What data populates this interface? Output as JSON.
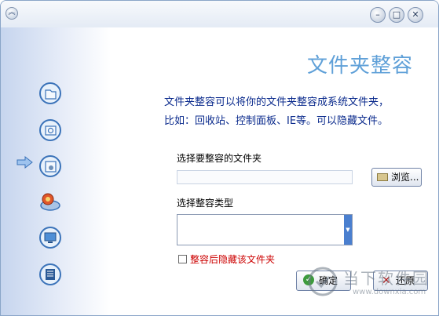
{
  "window": {
    "heading": "文件夹整容",
    "description_line1": "文件夹整容可以将你的文件夹整容成系统文件夹，",
    "description_line2": "比如：回收站、控制面板、IE等。可以隐藏文件。"
  },
  "titlebar": {
    "sysmenu_icon": "chevron-icon",
    "buttons": [
      {
        "name": "minimize",
        "glyph": "–"
      },
      {
        "name": "maximize",
        "glyph": "□"
      },
      {
        "name": "close",
        "glyph": "✕"
      }
    ]
  },
  "sidebar": {
    "selected_index": 2,
    "items": [
      {
        "icon": "folder-icon"
      },
      {
        "icon": "camera-folder-icon"
      },
      {
        "icon": "settings-folder-icon"
      },
      {
        "icon": "disk-tools-icon"
      },
      {
        "icon": "monitor-icon"
      },
      {
        "icon": "system-info-icon"
      }
    ]
  },
  "form": {
    "folder_label": "选择要整容的文件夹",
    "folder_value": "",
    "browse_label": "浏览...",
    "type_label": "选择整容类型",
    "type_value": "",
    "hide_checkbox_label": "整容后隐藏该文件夹",
    "hide_checked": false
  },
  "footer": {
    "ok_label": "确定",
    "cancel_label": "还原"
  },
  "watermark": {
    "text": "当下软件园",
    "url": "www.downxia.com"
  },
  "colors": {
    "heading": "#5fa0d8",
    "description": "#0a2a8c",
    "checkbox_label": "#cc0000",
    "select_arrow": "#4a7fcf"
  }
}
